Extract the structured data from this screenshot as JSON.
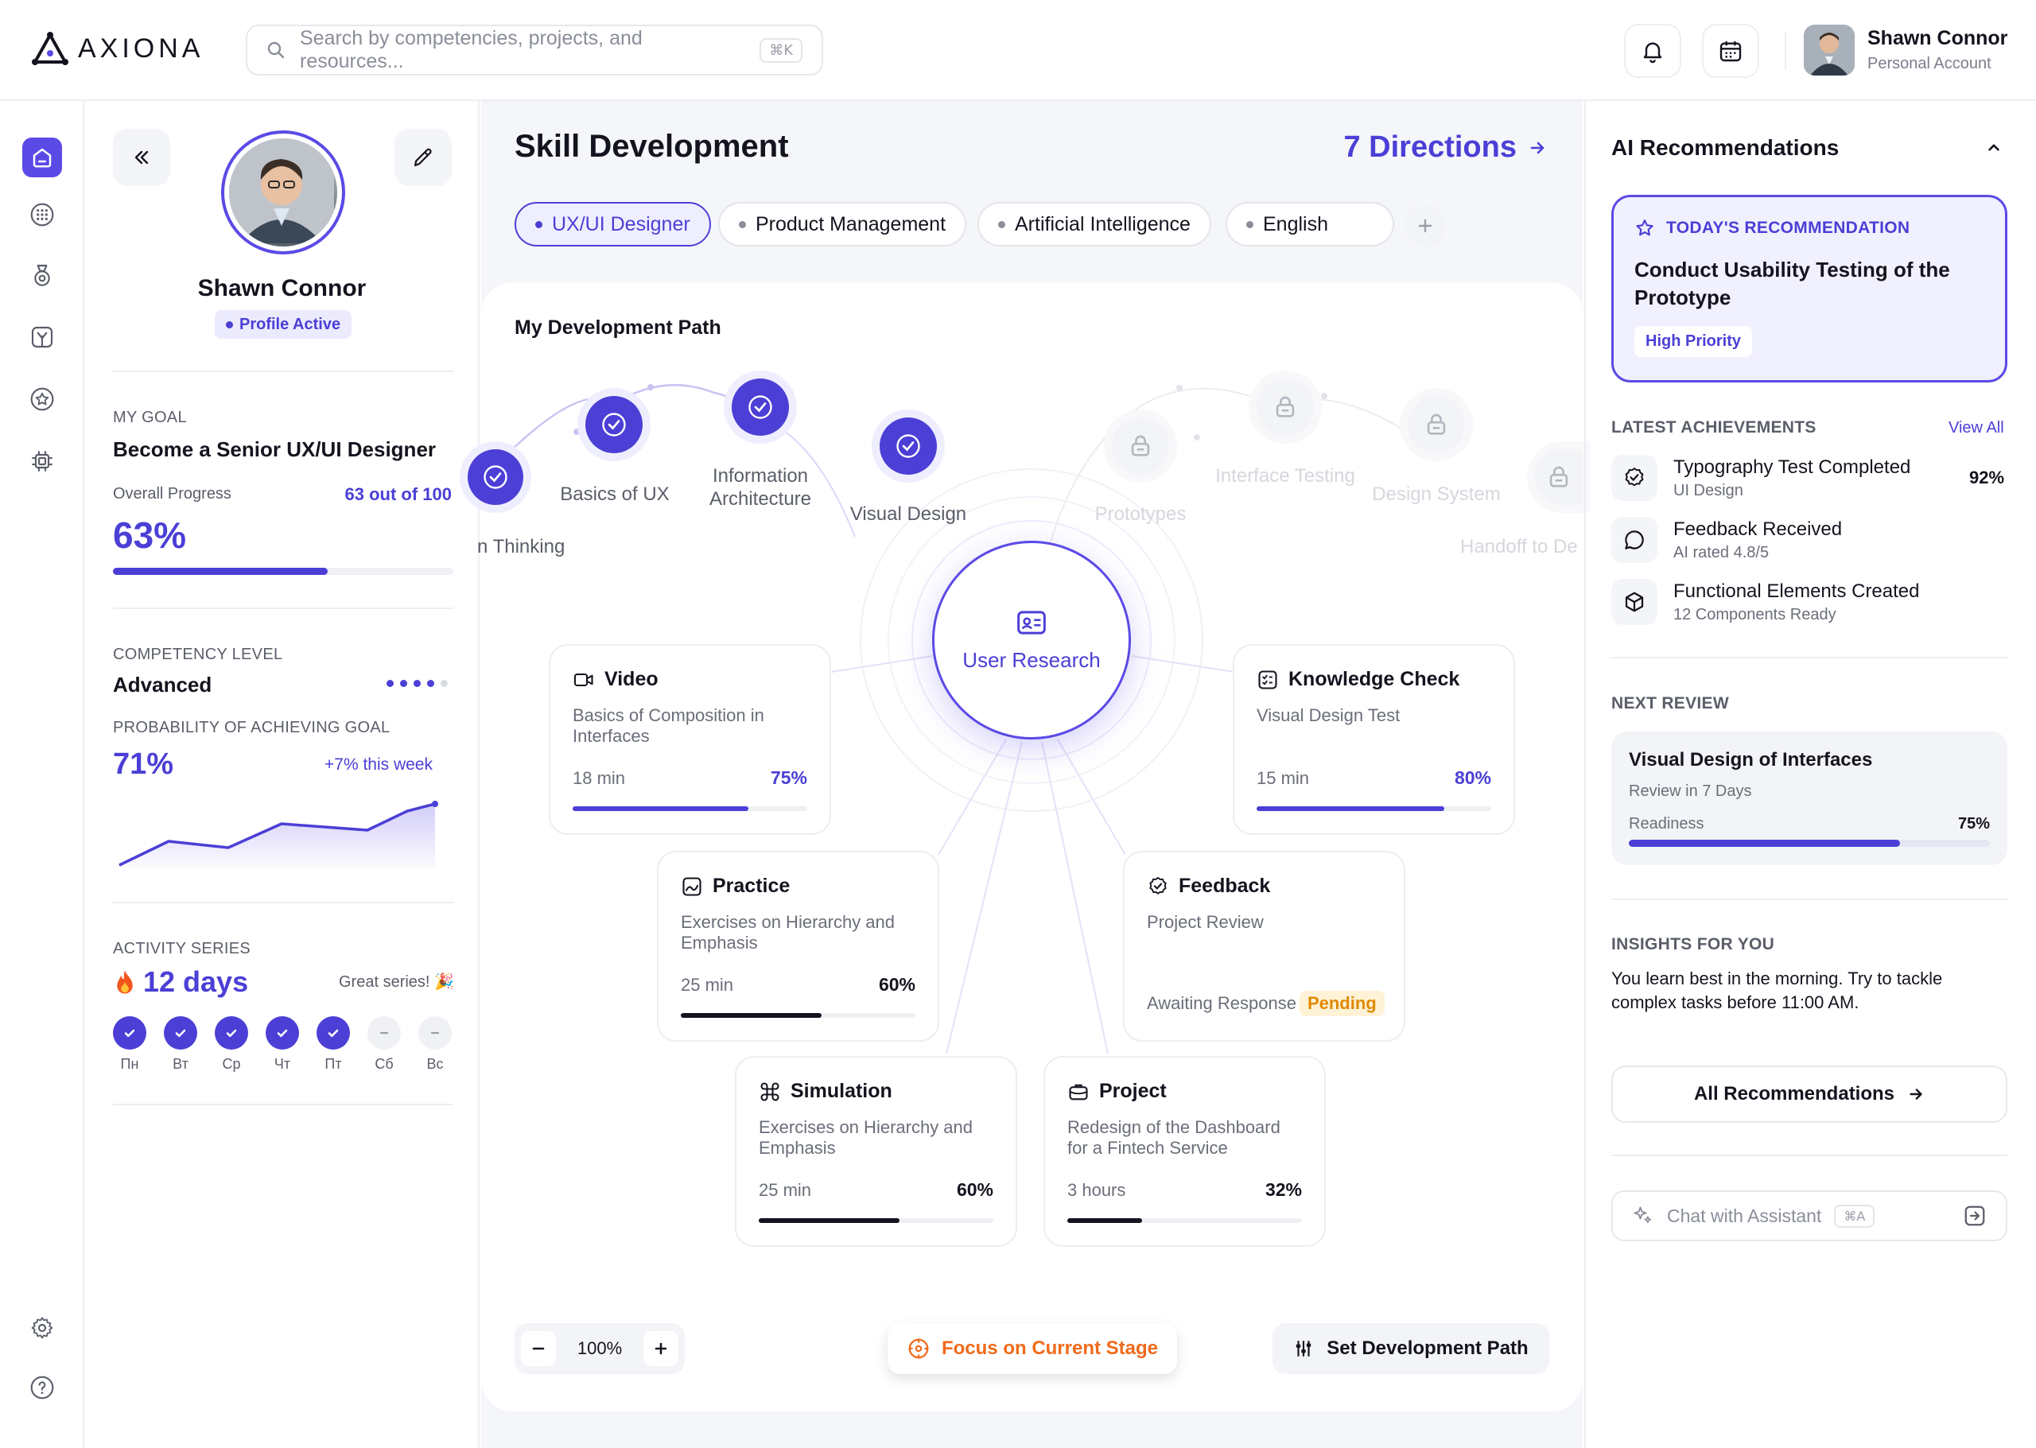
{
  "header": {
    "logo_text": "AXIONA",
    "search_placeholder": "Search by competencies, projects, and resources...",
    "search_shortcut": "⌘K",
    "user_name": "Shawn Connor",
    "user_role": "Personal Account"
  },
  "profile": {
    "name": "Shawn Connor",
    "status": "Profile Active",
    "goal_caption": "MY GOAL",
    "goal": "Become a Senior UX/UI Designer",
    "progress_label": "Overall Progress",
    "progress_count": "63 out of 100",
    "progress_percent": "63%",
    "progress_value": 0.63,
    "competency_caption": "COMPETENCY LEVEL",
    "competency": "Advanced",
    "competency_level": 4,
    "competency_max": 5,
    "probability_caption": "PROBABILITY OF ACHIEVING GOAL",
    "probability": "71%",
    "probability_delta": "+7% this week",
    "activity_caption": "ACTIVITY SERIES",
    "streak": "12 days",
    "streak_note": "Great series! 🎉",
    "days": [
      {
        "label": "Пн",
        "done": true
      },
      {
        "label": "Вт",
        "done": true
      },
      {
        "label": "Ср",
        "done": true
      },
      {
        "label": "Чт",
        "done": true
      },
      {
        "label": "Пт",
        "done": true
      },
      {
        "label": "Сб",
        "done": false
      },
      {
        "label": "Вс",
        "done": false
      }
    ]
  },
  "main": {
    "title": "Skill Development",
    "directions": "7 Directions",
    "chips": [
      "UX/UI Designer",
      "Product Management",
      "Artificial Intelligence",
      "English"
    ],
    "path_title": "My Development Path",
    "path_nodes": [
      {
        "label": "n Thinking",
        "state": "done"
      },
      {
        "label": "Basics of UX",
        "state": "done"
      },
      {
        "label": "Information Architecture",
        "state": "done"
      },
      {
        "label": "Visual Design",
        "state": "done"
      },
      {
        "label": "Prototypes",
        "state": "locked"
      },
      {
        "label": "Interface Testing",
        "state": "locked"
      },
      {
        "label": "Design System",
        "state": "locked"
      },
      {
        "label": "Handoff to De",
        "state": "locked"
      }
    ],
    "hub_label": "User Research",
    "cards": {
      "video": {
        "title": "Video",
        "desc": "Basics of Composition in Interfaces",
        "meta": "18 min",
        "percent": "75%",
        "value": 0.75
      },
      "knowledge": {
        "title": "Knowledge Check",
        "desc": "Visual Design Test",
        "meta": "15 min",
        "percent": "80%",
        "value": 0.8
      },
      "practice": {
        "title": "Practice",
        "desc": "Exercises on Hierarchy and Emphasis",
        "meta": "25 min",
        "percent": "60%",
        "value": 0.6
      },
      "feedback": {
        "title": "Feedback",
        "desc": "Project Review",
        "meta": "Awaiting Response",
        "status": "Pending"
      },
      "simulation": {
        "title": "Simulation",
        "desc": "Exercises on Hierarchy and Emphasis",
        "meta": "25 min",
        "percent": "60%",
        "value": 0.6
      },
      "project": {
        "title": "Project",
        "desc": "Redesign of the Dashboard for a Fintech Service",
        "meta": "3 hours",
        "percent": "32%",
        "value": 0.32
      }
    },
    "zoom": "100%",
    "focus_label": "Focus on Current Stage",
    "set_path_label": "Set Development Path"
  },
  "ai": {
    "title": "AI Recommendations",
    "rec_caption": "TODAY'S RECOMMENDATION",
    "rec_text": "Conduct Usability Testing of the Prototype",
    "rec_priority": "High Priority",
    "achievements_caption": "LATEST ACHIEVEMENTS",
    "view_all": "View All",
    "achievements": [
      {
        "title": "Typography Test Completed",
        "sub": "UI Design",
        "value": "92%",
        "icon": "check-badge-icon"
      },
      {
        "title": "Feedback Received",
        "sub": "AI rated 4.8/5",
        "value": "",
        "icon": "chat-bubble-icon"
      },
      {
        "title": "Functional Elements Created",
        "sub": "12 Components Ready",
        "value": "",
        "icon": "cube-icon"
      }
    ],
    "next_review_caption": "NEXT REVIEW",
    "review_title": "Visual Design of Interfaces",
    "review_sub": "Review in 7 Days",
    "readiness_label": "Readiness",
    "readiness": "75%",
    "readiness_value": 0.75,
    "insights_caption": "INSIGHTS FOR YOU",
    "insights_text": "You learn best in the morning. Try to tackle complex tasks before 11:00 AM.",
    "all_recs_label": "All Recommendations",
    "chat_placeholder": "Chat with Assistant",
    "chat_shortcut": "⌘A"
  },
  "colors": {
    "accent": "#4b3fd6",
    "orange": "#f06a1a",
    "pending_bg": "#fff2d6",
    "pending_text": "#e08a00"
  }
}
